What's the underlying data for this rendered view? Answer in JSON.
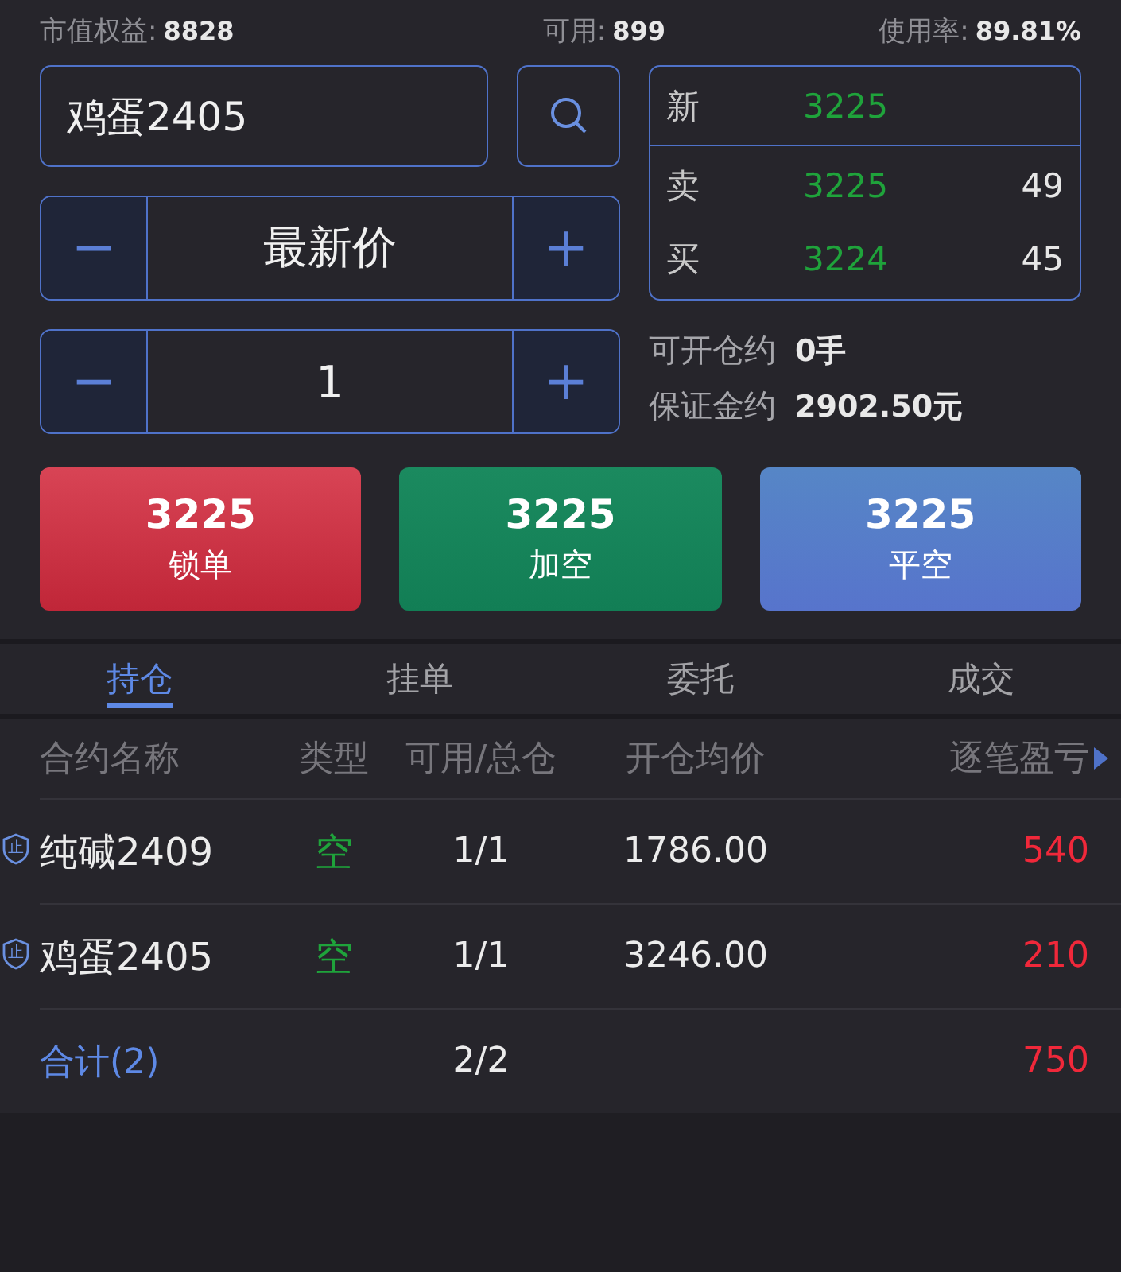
{
  "account": [
    {
      "label": "市值权益:",
      "value": "8828"
    },
    {
      "label": "可用:",
      "value": "899"
    },
    {
      "label": "使用率:",
      "value": "89.81%"
    }
  ],
  "contract_field": {
    "value": "鸡蛋2405"
  },
  "price_stepper": {
    "minus": "−",
    "value": "最新价",
    "plus": "+"
  },
  "qty_stepper": {
    "minus": "−",
    "value": "1",
    "plus": "+"
  },
  "quote": {
    "last": {
      "label": "新",
      "price": "3225"
    },
    "levels": [
      {
        "label": "卖",
        "price": "3225",
        "volume": "49"
      },
      {
        "label": "买",
        "price": "3224",
        "volume": "45"
      }
    ]
  },
  "info": [
    {
      "label": "可开仓约",
      "value": "0手"
    },
    {
      "label": "保证金约",
      "value": "2902.50元"
    }
  ],
  "actions": [
    {
      "kind": "lock",
      "price": "3225",
      "label": "锁单"
    },
    {
      "kind": "short",
      "price": "3225",
      "label": "加空"
    },
    {
      "kind": "close",
      "price": "3225",
      "label": "平空"
    }
  ],
  "tabs": [
    {
      "label": "持仓",
      "selected": true
    },
    {
      "label": "挂单",
      "selected": false
    },
    {
      "label": "委托",
      "selected": false
    },
    {
      "label": "成交",
      "selected": false
    }
  ],
  "table": {
    "columns": [
      "合约名称",
      "类型",
      "可用/总仓",
      "开仓均价",
      "逐笔盈亏"
    ],
    "rows": [
      {
        "stop_mark": "止",
        "name": "纯碱2409",
        "type": "空",
        "available": "1/1",
        "avg_price": "1786.00",
        "pnl": "540"
      },
      {
        "stop_mark": "止",
        "name": "鸡蛋2405",
        "type": "空",
        "available": "1/1",
        "avg_price": "3246.00",
        "pnl": "210"
      }
    ],
    "total": {
      "label": "合计(2)",
      "available": "2/2",
      "pnl": "750"
    }
  }
}
